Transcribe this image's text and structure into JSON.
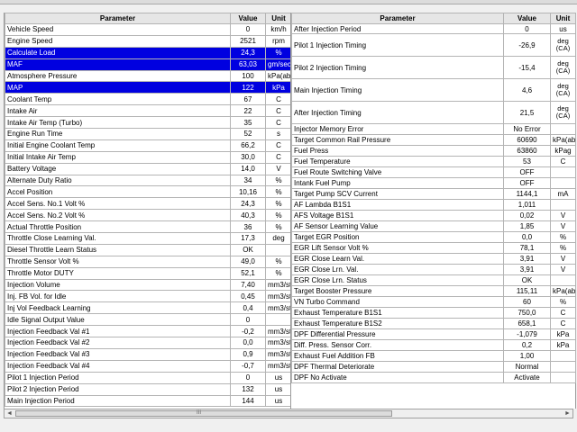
{
  "headers": {
    "param": "Parameter",
    "value": "Value",
    "unit": "Unit"
  },
  "left_rows": [
    {
      "p": "Vehicle Speed",
      "v": "0",
      "u": "km/h"
    },
    {
      "p": "Engine Speed",
      "v": "2521",
      "u": "rpm"
    },
    {
      "p": "Calculate Load",
      "v": "24,3",
      "u": "%",
      "sel": true
    },
    {
      "p": "MAF",
      "v": "63,03",
      "u": "gm/sec",
      "sel": true
    },
    {
      "p": "Atmosphere Pressure",
      "v": "100",
      "u": "kPa(abs)"
    },
    {
      "p": "MAP",
      "v": "122",
      "u": "kPa",
      "sel": true
    },
    {
      "p": "Coolant Temp",
      "v": "67",
      "u": "C"
    },
    {
      "p": "Intake Air",
      "v": "22",
      "u": "C"
    },
    {
      "p": "Intake Air Temp (Turbo)",
      "v": "35",
      "u": "C"
    },
    {
      "p": "Engine Run Time",
      "v": "52",
      "u": "s"
    },
    {
      "p": "Initial Engine Coolant Temp",
      "v": "66,2",
      "u": "C"
    },
    {
      "p": "Initial Intake Air Temp",
      "v": "30,0",
      "u": "C"
    },
    {
      "p": "Battery Voltage",
      "v": "14,0",
      "u": "V"
    },
    {
      "p": "Alternate Duty Ratio",
      "v": "34",
      "u": "%"
    },
    {
      "p": "Accel Position",
      "v": "10,16",
      "u": "%"
    },
    {
      "p": "Accel Sens. No.1 Volt %",
      "v": "24,3",
      "u": "%"
    },
    {
      "p": "Accel Sens. No.2 Volt %",
      "v": "40,3",
      "u": "%"
    },
    {
      "p": "Actual Throttle Position",
      "v": "36",
      "u": "%"
    },
    {
      "p": "Throttle Close Learning Val.",
      "v": "17,3",
      "u": "deg"
    },
    {
      "p": "Diesel Throttle Learn Status",
      "v": "OK",
      "u": ""
    },
    {
      "p": "Throttle Sensor Volt %",
      "v": "49,0",
      "u": "%"
    },
    {
      "p": "Throttle Motor DUTY",
      "v": "52,1",
      "u": "%"
    },
    {
      "p": "Injection Volume",
      "v": "7,40",
      "u": "mm3/st"
    },
    {
      "p": "Inj. FB Vol. for Idle",
      "v": "0,45",
      "u": "mm3/st"
    },
    {
      "p": "Inj Vol Feedback Learning",
      "v": "0,4",
      "u": "mm3/st"
    },
    {
      "p": "Idle Signal Output Value",
      "v": "0",
      "u": ""
    },
    {
      "p": "Injection Feedback Val #1",
      "v": "-0,2",
      "u": "mm3/st"
    },
    {
      "p": "Injection Feedback Val #2",
      "v": "0,0",
      "u": "mm3/st"
    },
    {
      "p": "Injection Feedback Val #3",
      "v": "0,9",
      "u": "mm3/st"
    },
    {
      "p": "Injection Feedback Val #4",
      "v": "-0,7",
      "u": "mm3/st"
    },
    {
      "p": "Pilot 1 Injection Period",
      "v": "0",
      "u": "us"
    },
    {
      "p": "Pilot 2 Injection Period",
      "v": "132",
      "u": "us"
    },
    {
      "p": "Main Injection Period",
      "v": "144",
      "u": "us"
    }
  ],
  "right_rows": [
    {
      "p": "After Injection Period",
      "v": "0",
      "u": "us",
      "h": 11
    },
    {
      "p": "Pilot 1 Injection Timing",
      "v": "-26,9",
      "u": "deg (CA)",
      "h": 25
    },
    {
      "p": "Pilot 2 Injection Timing",
      "v": "-15,4",
      "u": "deg (CA)",
      "h": 25
    },
    {
      "p": "Main Injection Timing",
      "v": "4,6",
      "u": "deg (CA)",
      "h": 25
    },
    {
      "p": "After Injection Timing",
      "v": "21,5",
      "u": "deg (CA)",
      "h": 25
    },
    {
      "p": "Injector Memory Error",
      "v": "No Error",
      "u": ""
    },
    {
      "p": "Target Common Rail Pressure",
      "v": "60690",
      "u": "kPa(abs)"
    },
    {
      "p": "Fuel Press",
      "v": "63860",
      "u": "kPag"
    },
    {
      "p": "Fuel Temperature",
      "v": "53",
      "u": "C"
    },
    {
      "p": "Fuel Route Switching Valve",
      "v": "OFF",
      "u": ""
    },
    {
      "p": "Intank Fuel Pump",
      "v": "OFF",
      "u": ""
    },
    {
      "p": "Target Pump SCV Current",
      "v": "1144,1",
      "u": "mA"
    },
    {
      "p": "AF Lambda B1S1",
      "v": "1,011",
      "u": ""
    },
    {
      "p": "AFS Voltage B1S1",
      "v": "0,02",
      "u": "V"
    },
    {
      "p": "AF Sensor Learning Value",
      "v": "1,85",
      "u": "V"
    },
    {
      "p": "Target EGR Position",
      "v": "0,0",
      "u": "%"
    },
    {
      "p": "EGR Lift Sensor Volt %",
      "v": "78,1",
      "u": "%"
    },
    {
      "p": "EGR Close Learn Val.",
      "v": "3,91",
      "u": "V"
    },
    {
      "p": "EGR Close Lrn. Val.",
      "v": "3,91",
      "u": "V"
    },
    {
      "p": "EGR Close Lrn. Status",
      "v": "OK",
      "u": ""
    },
    {
      "p": "Target Booster Pressure",
      "v": "115,11",
      "u": "kPa(abs)"
    },
    {
      "p": "VN Turbo Command",
      "v": "60",
      "u": "%"
    },
    {
      "p": "Exhaust Temperature B1S1",
      "v": "750,0",
      "u": "C"
    },
    {
      "p": "Exhaust Temperature B1S2",
      "v": "658,1",
      "u": "C"
    },
    {
      "p": "DPF Differential Pressure",
      "v": "-1,079",
      "u": "kPa"
    },
    {
      "p": "Diff. Press. Sensor Corr.",
      "v": "0,2",
      "u": "kPa"
    },
    {
      "p": "Exhaust Fuel Addition FB",
      "v": "1,00",
      "u": ""
    },
    {
      "p": "DPF Thermal Deteriorate",
      "v": "Normal",
      "u": ""
    },
    {
      "p": "DPF No Activate",
      "v": "Activate",
      "u": ""
    }
  ],
  "scrollbar": {
    "left_arrow": "◄",
    "right_arrow": "►",
    "grip": "III"
  },
  "colors": {
    "selection": "#0000e0",
    "header_bg": "#e6e6e6",
    "grid": "#b4b4b4"
  }
}
